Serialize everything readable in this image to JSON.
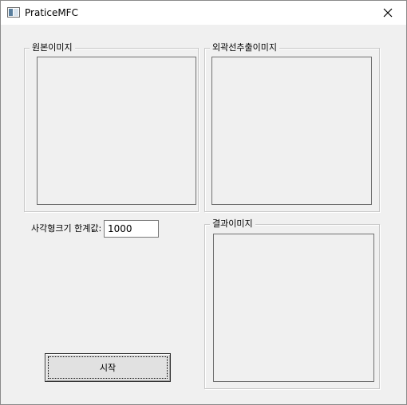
{
  "window": {
    "title": "PraticeMFC"
  },
  "groups": {
    "original": {
      "label": "원본이미지"
    },
    "edge": {
      "label": "외곽선추출이미지"
    },
    "result": {
      "label": "결과이미지"
    }
  },
  "threshold": {
    "label": "사각형크기 한계값:",
    "value": "1000"
  },
  "actions": {
    "start_label": "시작"
  },
  "icons": {
    "app": "app-window-icon",
    "close": "close-icon"
  }
}
